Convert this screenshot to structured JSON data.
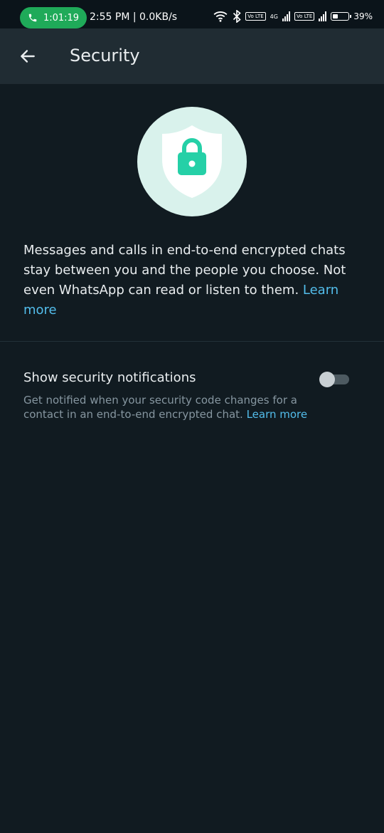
{
  "status_bar": {
    "call_timer": "1:01:19",
    "info": "2:55 PM | 0.0KB/s",
    "network_label": "4G",
    "volte_label": "Vo LTE",
    "battery_percent": "39%",
    "battery_level": 0.39
  },
  "app_bar": {
    "title": "Security"
  },
  "intro": {
    "text": "Messages and calls in end-to-end encrypted chats stay between you and the people you choose. Not even WhatsApp can read or listen to them. ",
    "link": "Learn more"
  },
  "security_notifications": {
    "title": "Show security notifications",
    "description": "Get notified when your security code changes for a contact in an end-to-end encrypted chat. ",
    "link": "Learn more",
    "enabled": false
  },
  "colors": {
    "background": "#111b21",
    "app_bar": "#202c33",
    "accent": "#25d0a7",
    "link": "#53bdeb",
    "call_pill": "#1faa59"
  },
  "icons": [
    "phone-icon",
    "wifi-icon",
    "bluetooth-icon",
    "signal-icon",
    "battery-icon",
    "back-arrow-icon",
    "shield-lock-icon"
  ]
}
